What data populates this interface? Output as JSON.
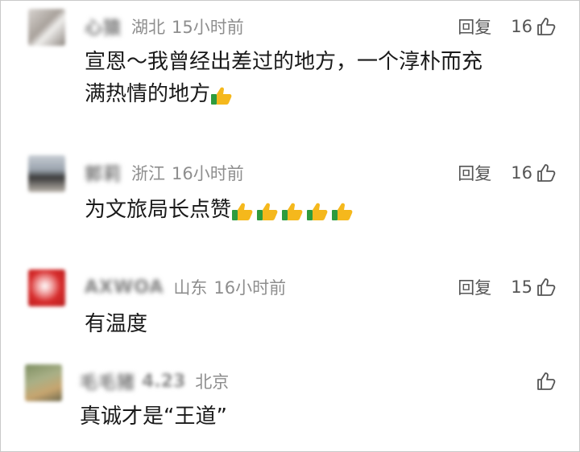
{
  "reply_label": "回复",
  "comments": [
    {
      "username": "心猿",
      "location": "湖北",
      "time": "15小时前",
      "likes": "16",
      "line1": "宣恩～我曾经出差过的地方，一个淳朴而充",
      "line2": "满热情的地方",
      "thumbs": 1
    },
    {
      "username": "郭莉",
      "location": "浙江",
      "time": "16小时前",
      "likes": "16",
      "line1": "为文旅局长点赞",
      "thumbs": 5
    },
    {
      "username": "AXWOA",
      "location": "山东",
      "time": "16小时前",
      "likes": "15",
      "line1": "有温度",
      "thumbs": 0
    },
    {
      "username": "毛毛猪",
      "userextra": "4.23",
      "location": "北京",
      "line1": "真诚才是“王道”",
      "thumbs": 0
    }
  ],
  "icons": {
    "like": "thumbs-up-outline-icon",
    "emoji": "thumbs-up-emoji-icon"
  },
  "colors": {
    "emoji_yellow": "#f5b81c",
    "emoji_sleeve": "#2e9b3e"
  }
}
